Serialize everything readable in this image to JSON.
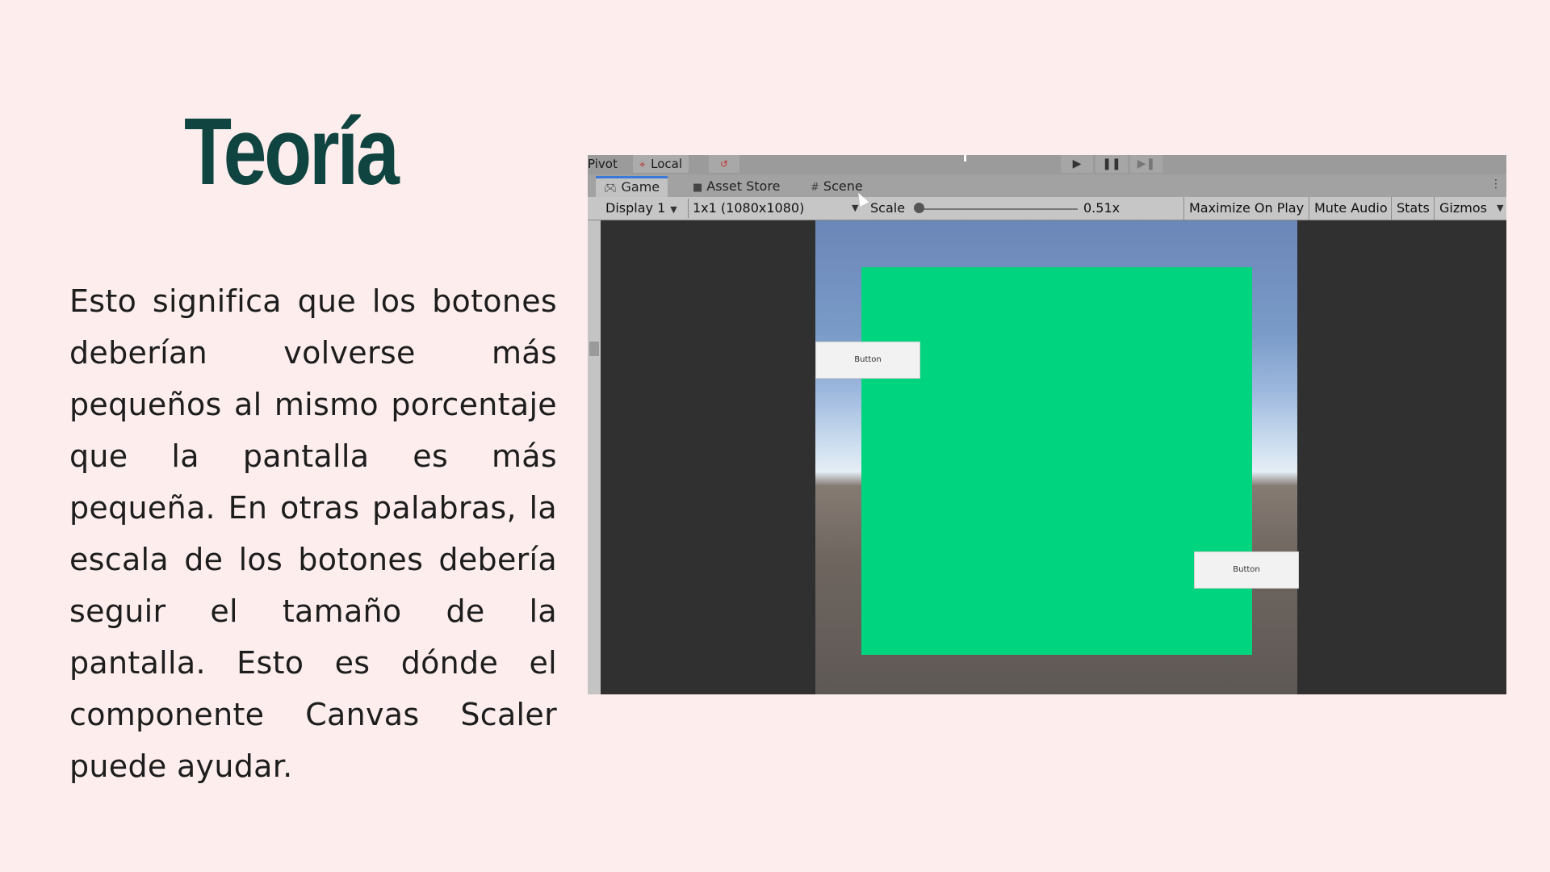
{
  "slide": {
    "title": "Teoría",
    "body": "Esto significa que los botones deberían volverse más pequeños al mismo porcentaje que la pantalla es más pequeña. En otras palabras, la escala de los botones debería seguir el tamaño de la pantalla. Esto es dónde el componente Canvas Scaler puede ayudar."
  },
  "editor": {
    "toolbar": {
      "pivot_label": "Pivot",
      "local_label": "Local",
      "local_icon": "local-space-icon",
      "play_icon": "play-icon",
      "pause_icon": "pause-icon",
      "step_icon": "step-icon"
    },
    "tabs": [
      {
        "label": "Game",
        "icon": "gamepad-icon",
        "active": true
      },
      {
        "label": "Asset Store",
        "icon": "shopping-bag-icon",
        "active": false
      },
      {
        "label": "Scene",
        "icon": "grid-icon",
        "active": false
      }
    ],
    "controls": {
      "display": "Display 1",
      "resolution": "1x1 (1080x1080)",
      "scale_label": "Scale",
      "scale_value": "0.51x",
      "scale_level": 0.0,
      "maximize": "Maximize On Play",
      "mute": "Mute Audio",
      "stats": "Stats",
      "gizmos": "Gizmos"
    },
    "game_view": {
      "panel_color": "#00d47e",
      "buttons": [
        "Button",
        "Button"
      ]
    }
  },
  "colors": {
    "background": "#fdeeed",
    "title": "#0f4441",
    "accent_tab": "#3a79d8"
  }
}
